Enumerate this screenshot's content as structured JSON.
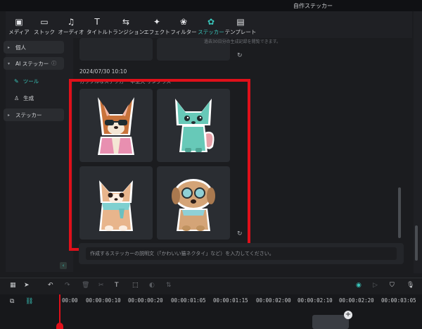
{
  "window": {
    "title": "自作ステッカー"
  },
  "toolbar": {
    "items": [
      {
        "label": "メディア",
        "icon": "media-icon"
      },
      {
        "label": "ストック",
        "icon": "stock-icon"
      },
      {
        "label": "オーディオ",
        "icon": "audio-icon"
      },
      {
        "label": "タイトル",
        "icon": "title-icon"
      },
      {
        "label": "トランジション",
        "icon": "transition-icon"
      },
      {
        "label": "エフェクト",
        "icon": "effect-icon"
      },
      {
        "label": "フィルター",
        "icon": "filter-icon"
      },
      {
        "label": "ステッカー",
        "icon": "sticker-icon",
        "active": true
      },
      {
        "label": "テンプレート",
        "icon": "template-icon"
      }
    ]
  },
  "sidebar": {
    "personal": "個人",
    "ai_sticker": "AI ステッカー",
    "tools": "ツール",
    "generate": "生成",
    "sticker": "ステッカー"
  },
  "main": {
    "note": "過去30日分の生成記録を閲覧できます。",
    "date": "2024/07/30 10:10",
    "prompt_line": "カラフルなステッカー 中型犬 サングラス",
    "stickers": [
      {
        "name": "corgi-sunglasses-sticker"
      },
      {
        "name": "teal-puppy-sticker"
      },
      {
        "name": "corgi-scarf-sticker"
      },
      {
        "name": "puppy-goggles-sticker"
      }
    ],
    "input_placeholder": "作成するステッカーの説明文（「かわいい猫ネクタイ」など）を入力してください。"
  },
  "timeline": {
    "ticks": [
      "00:00",
      "00:00:00:10",
      "00:00:00:20",
      "00:00:01:05",
      "00:00:01:15",
      "00:00:02:00",
      "00:00:02:10",
      "00:00:02:20",
      "00:00:03:05"
    ]
  },
  "colors": {
    "accent": "#39c5ba",
    "highlight": "#e0101a",
    "background": "#1b1c1f"
  }
}
